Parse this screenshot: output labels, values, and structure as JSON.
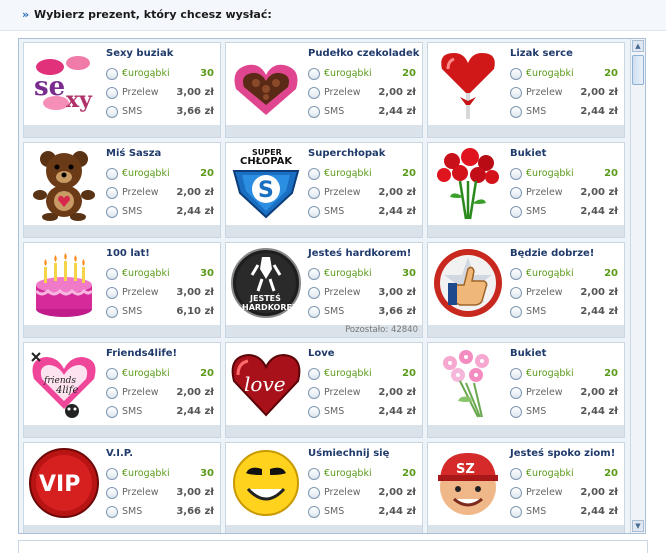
{
  "header": {
    "arrow": "»",
    "title": "Wybierz prezent, który chcesz wysłać:"
  },
  "labels": {
    "euro": "€urogąbki",
    "transfer": "Przelew",
    "sms": "SMS"
  },
  "gifts": [
    {
      "name": "Sexy buziak",
      "euro": "30",
      "transfer": "3,00 zł",
      "sms": "3,66 zł",
      "icon": "sexy-lips-icon",
      "footer": ""
    },
    {
      "name": "Pudełko czekoladek",
      "euro": "20",
      "transfer": "2,00 zł",
      "sms": "2,44 zł",
      "icon": "chocolate-box-icon",
      "footer": ""
    },
    {
      "name": "Lizak serce",
      "euro": "20",
      "transfer": "2,00 zł",
      "sms": "2,44 zł",
      "icon": "heart-lollipop-icon",
      "footer": ""
    },
    {
      "name": "Miś Sasza",
      "euro": "20",
      "transfer": "2,00 zł",
      "sms": "2,44 zł",
      "icon": "teddy-bear-icon",
      "footer": ""
    },
    {
      "name": "Superchłopak",
      "euro": "20",
      "transfer": "2,00 zł",
      "sms": "2,44 zł",
      "icon": "superboy-badge-icon",
      "footer": ""
    },
    {
      "name": "Bukiet",
      "euro": "20",
      "transfer": "2,00 zł",
      "sms": "2,44 zł",
      "icon": "red-roses-icon",
      "footer": ""
    },
    {
      "name": "100 lat!",
      "euro": "30",
      "transfer": "3,00 zł",
      "sms": "6,10 zł",
      "icon": "birthday-cake-icon",
      "footer": ""
    },
    {
      "name": "Jesteś hardkorem!",
      "euro": "30",
      "transfer": "3,00 zł",
      "sms": "3,66 zł",
      "icon": "hardkor-badge-icon",
      "footer": "Pozostało: 42840"
    },
    {
      "name": "Będzie dobrze!",
      "euro": "20",
      "transfer": "2,00 zł",
      "sms": "2,44 zł",
      "icon": "thumbs-up-icon",
      "footer": ""
    },
    {
      "name": "Friends4life!",
      "euro": "20",
      "transfer": "2,00 zł",
      "sms": "2,44 zł",
      "icon": "friends-heart-icon",
      "footer": ""
    },
    {
      "name": "Love",
      "euro": "20",
      "transfer": "2,00 zł",
      "sms": "2,44 zł",
      "icon": "love-heart-icon",
      "footer": ""
    },
    {
      "name": "Bukiet",
      "euro": "20",
      "transfer": "2,00 zł",
      "sms": "2,44 zł",
      "icon": "pink-flowers-icon",
      "footer": ""
    },
    {
      "name": "V.I.P.",
      "euro": "30",
      "transfer": "3,00 zł",
      "sms": "3,66 zł",
      "icon": "vip-badge-icon",
      "footer": ""
    },
    {
      "name": "Uśmiechnij się",
      "euro": "20",
      "transfer": "2,00 zł",
      "sms": "2,44 zł",
      "icon": "smiley-icon",
      "footer": ""
    },
    {
      "name": "Jesteś spoko ziom!",
      "euro": "20",
      "transfer": "2,00 zł",
      "sms": "2,44 zł",
      "icon": "sz-cap-face-icon",
      "footer": ""
    }
  ],
  "scrollbar": {
    "up": "▲",
    "down": "▼"
  },
  "colors": {
    "euro": "#5a9a1a",
    "name": "#1f3a6b",
    "border": "#a9c0d8"
  }
}
